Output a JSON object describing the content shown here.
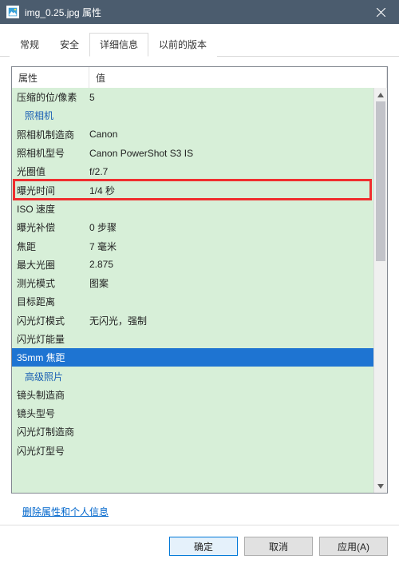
{
  "titlebar": {
    "title": "img_0.25.jpg 属性"
  },
  "tabs": {
    "items": [
      "常规",
      "安全",
      "详细信息",
      "以前的版本"
    ],
    "active_index": 2
  },
  "header": {
    "prop_col": "属性",
    "val_col": "值"
  },
  "rows": [
    {
      "kind": "kv",
      "prop": "压缩的位/像素",
      "val": "5"
    },
    {
      "kind": "section",
      "prop": "照相机",
      "val": ""
    },
    {
      "kind": "kv",
      "prop": "照相机制造商",
      "val": "Canon"
    },
    {
      "kind": "kv",
      "prop": "照相机型号",
      "val": "Canon PowerShot S3 IS"
    },
    {
      "kind": "kv",
      "prop": "光圈值",
      "val": "f/2.7"
    },
    {
      "kind": "kv",
      "prop": "曝光时间",
      "val": "1/4 秒",
      "highlight": true
    },
    {
      "kind": "kv",
      "prop": "ISO 速度",
      "val": ""
    },
    {
      "kind": "kv",
      "prop": "曝光补偿",
      "val": "0 步骤"
    },
    {
      "kind": "kv",
      "prop": "焦距",
      "val": "7 毫米"
    },
    {
      "kind": "kv",
      "prop": "最大光圈",
      "val": "2.875"
    },
    {
      "kind": "kv",
      "prop": "测光模式",
      "val": "图案"
    },
    {
      "kind": "kv",
      "prop": "目标距离",
      "val": ""
    },
    {
      "kind": "kv",
      "prop": "闪光灯模式",
      "val": "无闪光，强制"
    },
    {
      "kind": "kv",
      "prop": "闪光灯能量",
      "val": ""
    },
    {
      "kind": "kv",
      "prop": "35mm 焦距",
      "val": "",
      "selected": true
    },
    {
      "kind": "section",
      "prop": "高级照片",
      "val": ""
    },
    {
      "kind": "kv",
      "prop": "镜头制造商",
      "val": ""
    },
    {
      "kind": "kv",
      "prop": "镜头型号",
      "val": ""
    },
    {
      "kind": "kv",
      "prop": "闪光灯制造商",
      "val": ""
    },
    {
      "kind": "kv",
      "prop": "闪光灯型号",
      "val": ""
    }
  ],
  "link": {
    "text": "删除属性和个人信息"
  },
  "footer": {
    "ok": "确定",
    "cancel": "取消",
    "apply": "应用(A)"
  }
}
